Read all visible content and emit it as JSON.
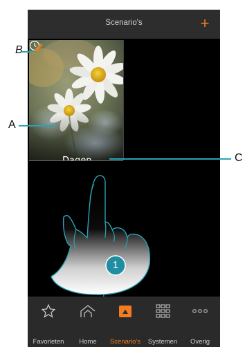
{
  "header": {
    "title": "Scenario's",
    "add_label": "+"
  },
  "scenario": {
    "name": "Dagen"
  },
  "callouts": {
    "a": "A",
    "b": "B",
    "c": "C"
  },
  "step": {
    "number": "1"
  },
  "bottom_nav": {
    "items": [
      {
        "label": "Favorieten",
        "icon": "star-icon",
        "active": false
      },
      {
        "label": "Home",
        "icon": "house-icon",
        "active": false
      },
      {
        "label": "Scenario's",
        "icon": "scenario-icon",
        "active": true
      },
      {
        "label": "Systemen",
        "icon": "grid-icon",
        "active": false
      },
      {
        "label": "Overig",
        "icon": "more-icon",
        "active": false
      }
    ]
  },
  "colors": {
    "accent": "#f47c20",
    "callout": "#2aa3b8",
    "header_bg": "#2d2d2d",
    "nav_bg": "#2a2a2a"
  }
}
